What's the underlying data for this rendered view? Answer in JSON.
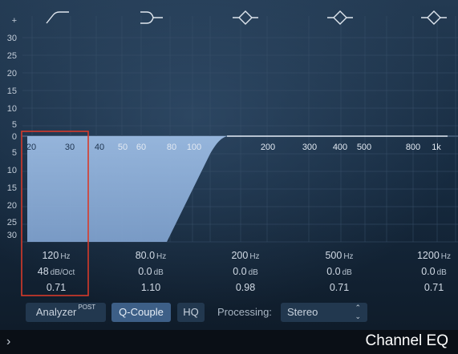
{
  "left_scale": [
    "+",
    "30",
    "25",
    "20",
    "15",
    "10",
    "5",
    "0",
    "5",
    "10",
    "15",
    "20",
    "25",
    "30"
  ],
  "freq_labels": [
    "20",
    "30",
    "40",
    "50",
    "60",
    "80",
    "100",
    "200",
    "300",
    "400",
    "500",
    "800",
    "1k"
  ],
  "band_icons": [
    "highpass-filter-icon",
    "low-shelf-icon",
    "peak-band-icon",
    "peak-band-icon",
    "peak-band-icon"
  ],
  "bands": [
    {
      "freq": "120",
      "freq_unit": "Hz",
      "gain": "48",
      "gain_unit": "dB/Oct",
      "q": "0.71"
    },
    {
      "freq": "80.0",
      "freq_unit": "Hz",
      "gain": "0.0",
      "gain_unit": "dB",
      "q": "1.10"
    },
    {
      "freq": "200",
      "freq_unit": "Hz",
      "gain": "0.0",
      "gain_unit": "dB",
      "q": "0.98"
    },
    {
      "freq": "500",
      "freq_unit": "Hz",
      "gain": "0.0",
      "gain_unit": "dB",
      "q": "0.71"
    },
    {
      "freq": "1200",
      "freq_unit": "Hz",
      "gain": "0.0",
      "gain_unit": "dB",
      "q": "0.71"
    }
  ],
  "controls": {
    "analyzer_label": "Analyzer",
    "analyzer_sup": "POST",
    "qcouple_label": "Q-Couple",
    "hq_label": "HQ",
    "processing_label": "Processing:",
    "processing_value": "Stereo"
  },
  "title": "Channel EQ",
  "colors": {
    "background": "#0f1c2a",
    "curve_fill": "#8fb0d9",
    "highlight_box": "#d63a2a",
    "button_active": "#3d5f87"
  }
}
